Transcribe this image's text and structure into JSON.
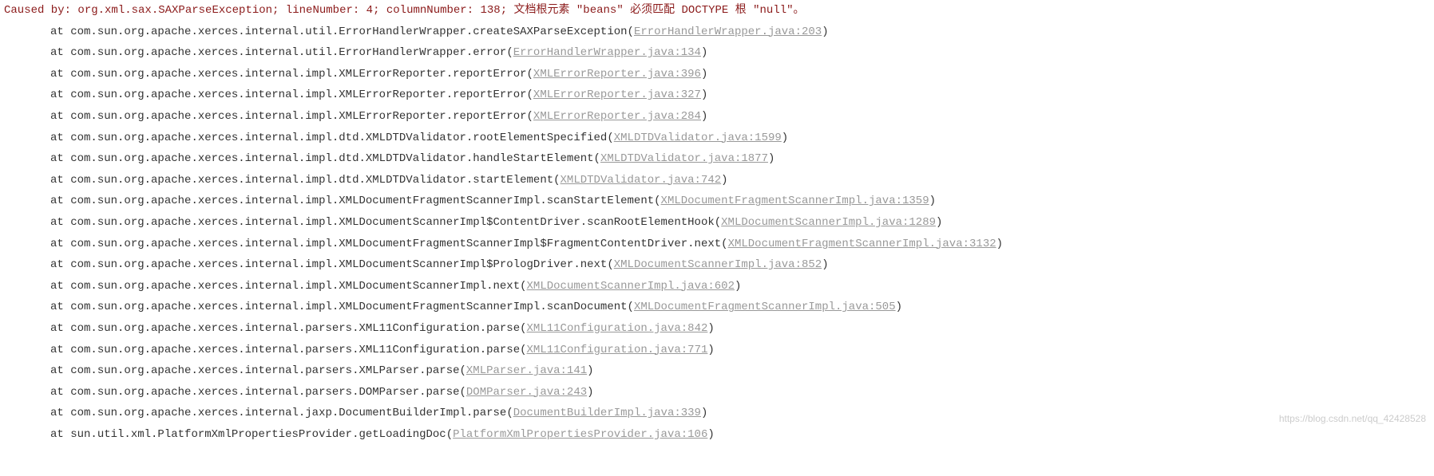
{
  "causedBy": "Caused by: org.xml.sax.SAXParseException; lineNumber: 4; columnNumber: 138; 文档根元素 \"beans\" 必须匹配 DOCTYPE 根 \"null\"。",
  "frames": [
    {
      "method": "com.sun.org.apache.xerces.internal.util.ErrorHandlerWrapper.createSAXParseException",
      "source": "ErrorHandlerWrapper.java:203"
    },
    {
      "method": "com.sun.org.apache.xerces.internal.util.ErrorHandlerWrapper.error",
      "source": "ErrorHandlerWrapper.java:134"
    },
    {
      "method": "com.sun.org.apache.xerces.internal.impl.XMLErrorReporter.reportError",
      "source": "XMLErrorReporter.java:396"
    },
    {
      "method": "com.sun.org.apache.xerces.internal.impl.XMLErrorReporter.reportError",
      "source": "XMLErrorReporter.java:327"
    },
    {
      "method": "com.sun.org.apache.xerces.internal.impl.XMLErrorReporter.reportError",
      "source": "XMLErrorReporter.java:284"
    },
    {
      "method": "com.sun.org.apache.xerces.internal.impl.dtd.XMLDTDValidator.rootElementSpecified",
      "source": "XMLDTDValidator.java:1599"
    },
    {
      "method": "com.sun.org.apache.xerces.internal.impl.dtd.XMLDTDValidator.handleStartElement",
      "source": "XMLDTDValidator.java:1877"
    },
    {
      "method": "com.sun.org.apache.xerces.internal.impl.dtd.XMLDTDValidator.startElement",
      "source": "XMLDTDValidator.java:742"
    },
    {
      "method": "com.sun.org.apache.xerces.internal.impl.XMLDocumentFragmentScannerImpl.scanStartElement",
      "source": "XMLDocumentFragmentScannerImpl.java:1359"
    },
    {
      "method": "com.sun.org.apache.xerces.internal.impl.XMLDocumentScannerImpl$ContentDriver.scanRootElementHook",
      "source": "XMLDocumentScannerImpl.java:1289"
    },
    {
      "method": "com.sun.org.apache.xerces.internal.impl.XMLDocumentFragmentScannerImpl$FragmentContentDriver.next",
      "source": "XMLDocumentFragmentScannerImpl.java:3132"
    },
    {
      "method": "com.sun.org.apache.xerces.internal.impl.XMLDocumentScannerImpl$PrologDriver.next",
      "source": "XMLDocumentScannerImpl.java:852"
    },
    {
      "method": "com.sun.org.apache.xerces.internal.impl.XMLDocumentScannerImpl.next",
      "source": "XMLDocumentScannerImpl.java:602"
    },
    {
      "method": "com.sun.org.apache.xerces.internal.impl.XMLDocumentFragmentScannerImpl.scanDocument",
      "source": "XMLDocumentFragmentScannerImpl.java:505"
    },
    {
      "method": "com.sun.org.apache.xerces.internal.parsers.XML11Configuration.parse",
      "source": "XML11Configuration.java:842"
    },
    {
      "method": "com.sun.org.apache.xerces.internal.parsers.XML11Configuration.parse",
      "source": "XML11Configuration.java:771"
    },
    {
      "method": "com.sun.org.apache.xerces.internal.parsers.XMLParser.parse",
      "source": "XMLParser.java:141"
    },
    {
      "method": "com.sun.org.apache.xerces.internal.parsers.DOMParser.parse",
      "source": "DOMParser.java:243"
    },
    {
      "method": "com.sun.org.apache.xerces.internal.jaxp.DocumentBuilderImpl.parse",
      "source": "DocumentBuilderImpl.java:339"
    },
    {
      "method": "sun.util.xml.PlatformXmlPropertiesProvider.getLoadingDoc",
      "source": "PlatformXmlPropertiesProvider.java:106"
    }
  ],
  "watermark": "https://blog.csdn.net/qq_42428528"
}
